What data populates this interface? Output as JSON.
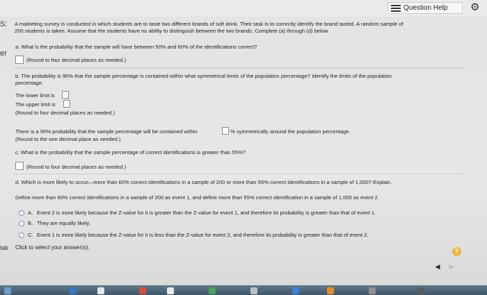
{
  "topbar": {
    "help_label": "Question Help",
    "help_icon": "list-icon",
    "settings_icon": "gear-icon"
  },
  "left_edge": {
    "frag1": "S:",
    "frag2": "er",
    "frag3": "tak"
  },
  "problem": {
    "intro_line1": "A marketing survey is conducted in which students are to taste two different brands of soft drink. Their task is to correctly identify the brand tasted. A random sample of",
    "intro_line2": "200 students is taken. Assume that the students have no ability to distinguish between the two brands. Complete (a) through (d) below."
  },
  "part_a": {
    "question": "a. What is the probability that the sample will have between 50% and 60% of the identifications correct?",
    "hint": "(Round to four decimal places as needed.)"
  },
  "part_b": {
    "question_line1": "b. The probability is 90% that the sample percentage is contained within what symmetrical limits of the population percentage? Identify the limits of the population",
    "question_line2": "percentage.",
    "lower_label": "The lower limit is",
    "upper_label": "The upper limit is",
    "hint": "(Round to four decimal places as needed.)",
    "statement_before": "There is a 90% probability that the sample percentage will be contained within",
    "statement_after": "% symmetrically around the population percentage.",
    "statement_hint": "(Round to the one decimal place as needed.)"
  },
  "part_c": {
    "question": "c. What is the probability that the sample percentage of correct identifications is greater than 55%?",
    "hint": "(Round to four decimal places as needed.)"
  },
  "part_d": {
    "question": "d. Which is more likely to occur—more than 60% correct identifications in a sample of 200 or more than 55% correct identifications in a sample of 1,000? Explain.",
    "definition": "Define more than 60% correct identifications in a sample of 200 as event 1, and define more than 55% correct identification in a sample of 1,000 as event 2.",
    "options": [
      {
        "letter": "A.",
        "text": "Event 2 is more likely because the Z-value for it is greater than the Z-value for event 1, and therefore its probability is greater than that of event 1."
      },
      {
        "letter": "B.",
        "text": "They are equally likely."
      },
      {
        "letter": "C.",
        "text": "Event 1 is more likely because the Z-value for it is less than the Z-value for event 2, and therefore its probability is greater than that of event 2."
      }
    ]
  },
  "footer": {
    "instruction": "Click to select your answer(s).",
    "help_symbol": "?",
    "prev_symbol": "◀",
    "next_symbol": "▶"
  },
  "colors": {
    "radio_border": "#7a8fb0",
    "help_circle": "#e8b83d"
  }
}
